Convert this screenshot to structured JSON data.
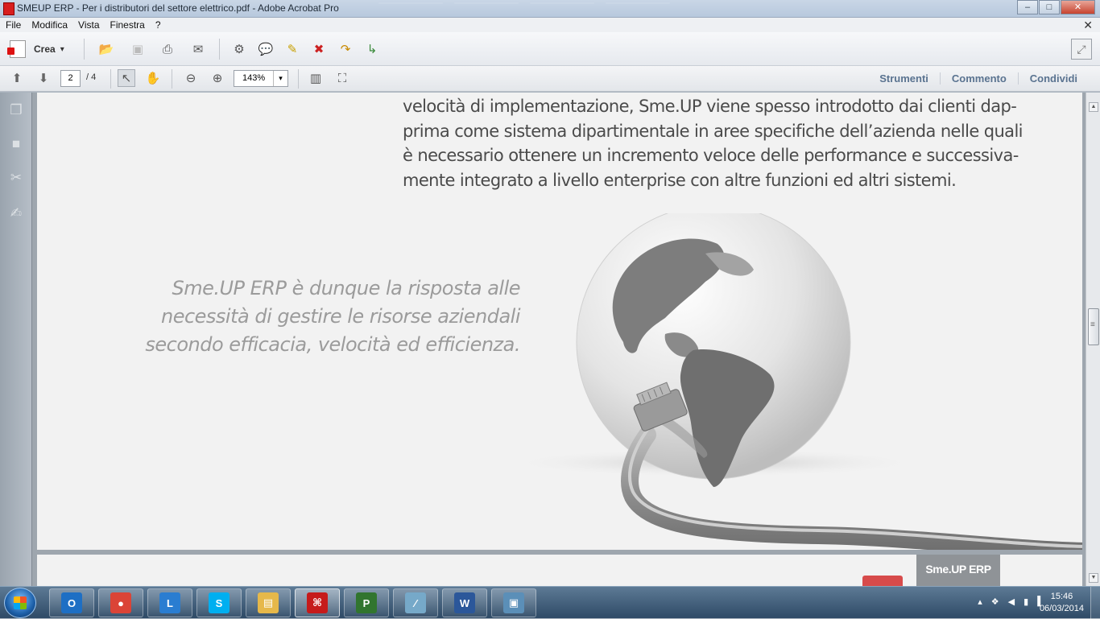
{
  "window": {
    "title": "SMEUP ERP - Per i distributori del settore elettrico.pdf - Adobe Acrobat Pro",
    "min": "–",
    "max": "□",
    "close": "✕"
  },
  "menubar": {
    "items": [
      "File",
      "Modifica",
      "Vista",
      "Finestra",
      "?"
    ],
    "close": "✕"
  },
  "toolbar": {
    "crea_label": "Crea",
    "crea_arrow": "▾",
    "page_current": "2",
    "page_total": "/ 4",
    "zoom_value": "143%",
    "zoom_arrow": "▾",
    "right_links": [
      "Strumenti",
      "Commento",
      "Condividi"
    ]
  },
  "document": {
    "body_text": "velocità di implementazione, Sme.UP viene spesso introdotto dai clienti dap-\nprima come sistema dipartimentale in aree specifiche dell’azienda nelle quali\nè necessario ottenere un incremento veloce delle performance e successiva-\nmente integrato a livello enterprise con altre funzioni ed altri sistemi.",
    "quote_lines": [
      "Sme.UP ERP è dunque la risposta alle",
      "necessità di gestire le risorse aziendali",
      "secondo efficacia, velocità ed efficienza."
    ],
    "page2_badge": "Sme.UP ERP"
  },
  "taskbar": {
    "apps": [
      {
        "name": "outlook",
        "glyph": "O",
        "color": "#1e6fc4"
      },
      {
        "name": "chrome",
        "glyph": "●",
        "color": "#db4437"
      },
      {
        "name": "lync",
        "glyph": "L",
        "color": "#2a7dd1"
      },
      {
        "name": "skype",
        "glyph": "S",
        "color": "#00aff0"
      },
      {
        "name": "explorer",
        "glyph": "▤",
        "color": "#e6b84a"
      },
      {
        "name": "acrobat",
        "glyph": "⌘",
        "color": "#c61b1b"
      },
      {
        "name": "project",
        "glyph": "P",
        "color": "#31752f"
      },
      {
        "name": "notepad",
        "glyph": "∕",
        "color": "#76a9c9"
      },
      {
        "name": "word",
        "glyph": "W",
        "color": "#2b579a"
      },
      {
        "name": "photos",
        "glyph": "▣",
        "color": "#5b8fb8"
      }
    ],
    "tray_icons": [
      "▴",
      "❖",
      "◀",
      "▮",
      "▌"
    ],
    "time": "15:46",
    "date": "06/03/2014"
  }
}
